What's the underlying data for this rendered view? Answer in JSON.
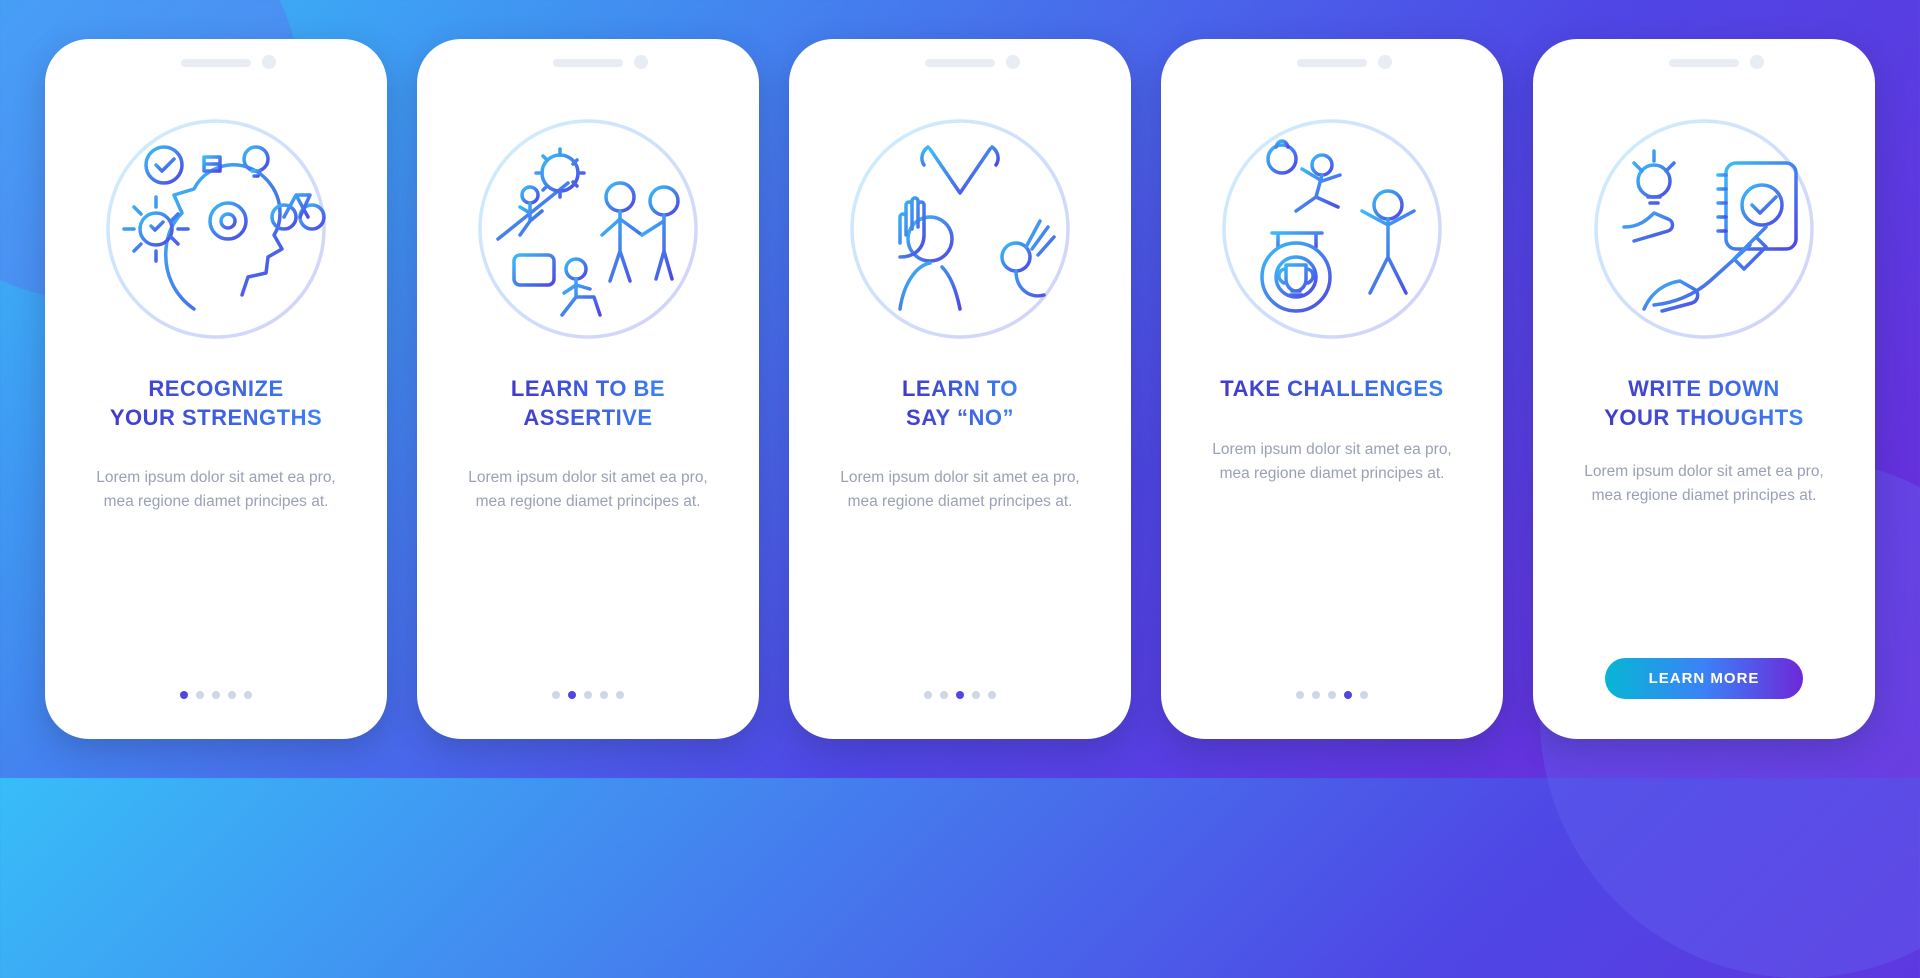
{
  "total_screens": 5,
  "cta_label": "LEARN MORE",
  "screens": [
    {
      "title": "RECOGNIZE\nYOUR STRENGTHS",
      "body": "Lorem ipsum dolor sit amet ea pro, mea regione diamet principes at.",
      "active_dot": 0,
      "icon": "strengths-icon",
      "has_cta": false
    },
    {
      "title": "LEARN TO BE\nASSERTIVE",
      "body": "Lorem ipsum dolor sit amet ea pro, mea regione diamet principes at.",
      "active_dot": 1,
      "icon": "assertive-icon",
      "has_cta": false
    },
    {
      "title": "LEARN TO\nSAY “NO”",
      "body": "Lorem ipsum dolor sit amet ea pro, mea regione diamet principes at.",
      "active_dot": 2,
      "icon": "say-no-icon",
      "has_cta": false
    },
    {
      "title": "TAKE CHALLENGES",
      "body": "Lorem ipsum dolor sit amet ea pro, mea regione diamet principes at.",
      "active_dot": 3,
      "icon": "challenges-icon",
      "has_cta": false
    },
    {
      "title": "WRITE DOWN\nYOUR THOUGHTS",
      "body": "Lorem ipsum dolor sit amet ea pro, mea regione diamet principes at.",
      "active_dot": 4,
      "icon": "write-icon",
      "has_cta": true
    }
  ]
}
